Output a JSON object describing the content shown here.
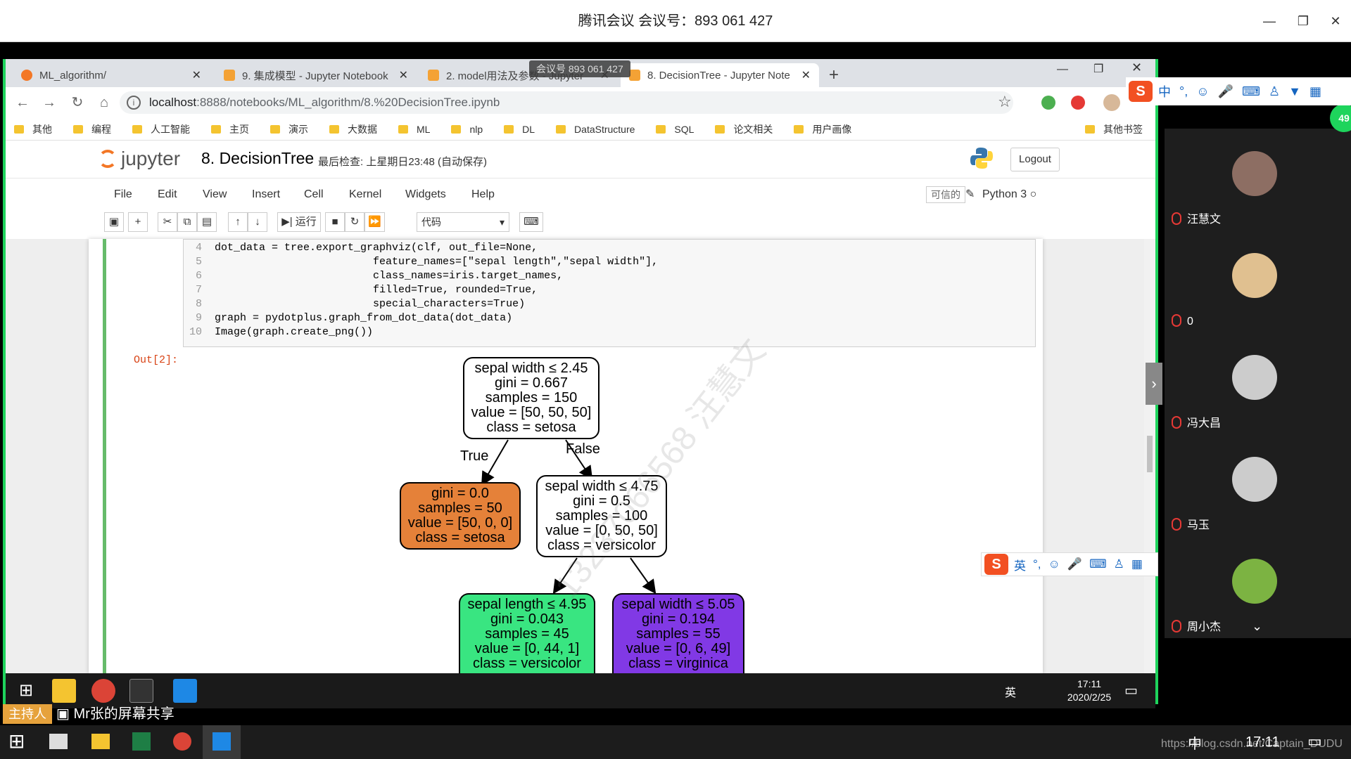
{
  "meeting": {
    "title": "腾讯会议 会议号：893 061 427",
    "overlay_id": "会议号 893 061 427"
  },
  "browser": {
    "tabs": [
      {
        "label": "ML_algorithm/",
        "color": "#f37726"
      },
      {
        "label": "9. 集成模型 - Jupyter Notebook",
        "color": "#f4a235"
      },
      {
        "label": "2. model用法及参数 - Jupyter",
        "color": "#f4a235"
      },
      {
        "label": "8. DecisionTree - Jupyter Note",
        "color": "#f4a235"
      }
    ],
    "url_host": "localhost",
    "url_rest": ":8888/notebooks/ML_algorithm/8.%20DecisionTree.ipynb",
    "bookmarks": [
      "其他",
      "编程",
      "人工智能",
      "主页",
      "演示",
      "大数据",
      "ML",
      "nlp",
      "DL",
      "DataStructure",
      "SQL",
      "论文相关",
      "用户画像"
    ],
    "other_bookmarks": "其他书签"
  },
  "jupyter": {
    "logo": "jupyter",
    "notebook_title": "8. DecisionTree",
    "checkpoint": "最后检查: 上星期日23:48",
    "autosave": "(自动保存)",
    "logout": "Logout",
    "menu": [
      "File",
      "Edit",
      "View",
      "Insert",
      "Cell",
      "Kernel",
      "Widgets",
      "Help"
    ],
    "trusted": "可信的",
    "kernel": "Python 3",
    "run_label": "运行",
    "cell_type": "代码",
    "out_prompt": "Out[2]:"
  },
  "code_lines": [
    {
      "n": "4",
      "text": "dot_data = tree.export_graphviz(clf, out_file=None,"
    },
    {
      "n": "5",
      "text": "                         feature_names=[\"sepal length\",\"sepal width\"],"
    },
    {
      "n": "6",
      "text": "                         class_names=iris.target_names,"
    },
    {
      "n": "7",
      "text": "                         filled=True, rounded=True,"
    },
    {
      "n": "8",
      "text": "                         special_characters=True)"
    },
    {
      "n": "9",
      "text": "graph = pydotplus.graph_from_dot_data(dot_data)"
    },
    {
      "n": "10",
      "text": "Image(graph.create_png())"
    }
  ],
  "tree": {
    "root": [
      "sepal width ≤ 2.45",
      "gini = 0.667",
      "samples = 150",
      "value = [50, 50, 50]",
      "class = setosa"
    ],
    "left": [
      "gini = 0.0",
      "samples = 50",
      "value = [50, 0, 0]",
      "class = setosa"
    ],
    "right": [
      "sepal width ≤ 4.75",
      "gini = 0.5",
      "samples = 100",
      "value = [0, 50, 50]",
      "class = versicolor"
    ],
    "rl": [
      "sepal length ≤ 4.95",
      "gini = 0.043",
      "samples = 45",
      "value = [0, 44, 1]",
      "class = versicolor"
    ],
    "rr": [
      "sepal width ≤ 5.05",
      "gini = 0.194",
      "samples = 55",
      "value = [0, 6, 49]",
      "class = virginica"
    ],
    "true_label": "True",
    "false_label": "False",
    "colors": {
      "white": "#ffffff",
      "orange": "#e58139",
      "green": "#39e581",
      "purple": "#8139e5"
    }
  },
  "watermark": "13237066568 汪慧文",
  "inner_taskbar": {
    "time": "17:11",
    "date": "2020/2/25",
    "lang": "英"
  },
  "host": {
    "badge": "主持人",
    "share_text": "Mr张的屏幕共享"
  },
  "participants": [
    {
      "name": "汪慧文"
    },
    {
      "name": "0"
    },
    {
      "name": "冯大昌"
    },
    {
      "name": "马玉"
    },
    {
      "name": "周小杰"
    }
  ],
  "ime": {
    "main": "中",
    "alt": "英"
  },
  "badge": "49",
  "windows": {
    "time": "17:11",
    "url_watermark": "https://blog.csdn.net/Captain_DUDU",
    "lang": "中"
  }
}
